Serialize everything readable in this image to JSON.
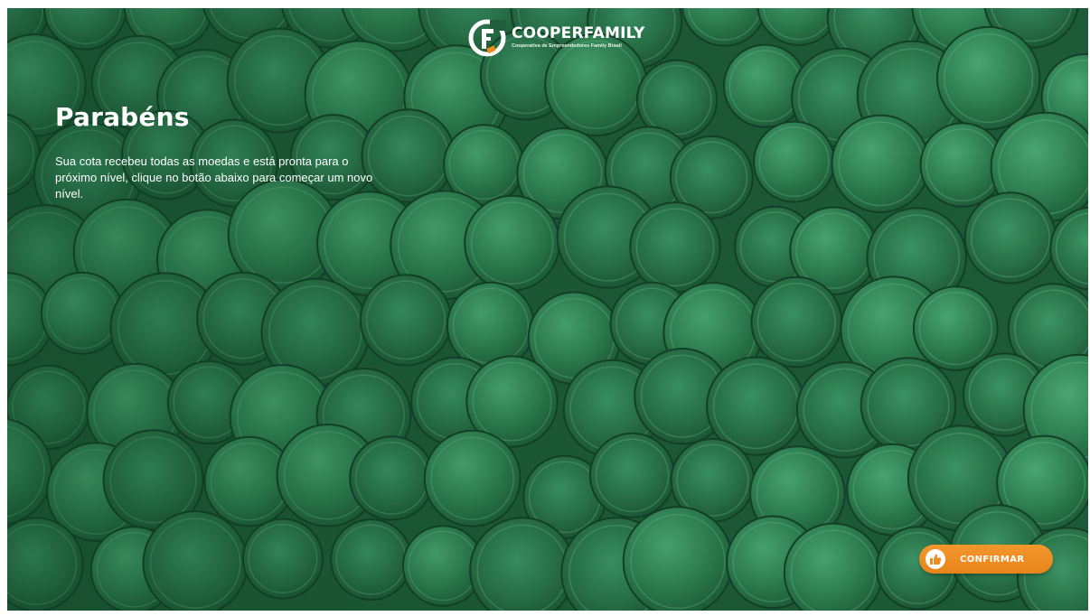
{
  "brand": {
    "name": "COOPERFAMILY",
    "tagline": "Cooperativa de Empreendedores Family Brasil",
    "colors": {
      "primary_green": "#1f5f3b",
      "accent_orange": "#ee8c22",
      "text": "#ffffff"
    }
  },
  "content": {
    "title": "Parabéns",
    "message": "Sua cota recebeu todas as moedas e está pronta para o próximo nível, clique no botão abaixo para começar um novo nível."
  },
  "actions": {
    "confirm_label": "CONFIRMAR",
    "confirm_icon": "thumbs-up-icon"
  },
  "background": {
    "image": "green-tinted coins"
  }
}
